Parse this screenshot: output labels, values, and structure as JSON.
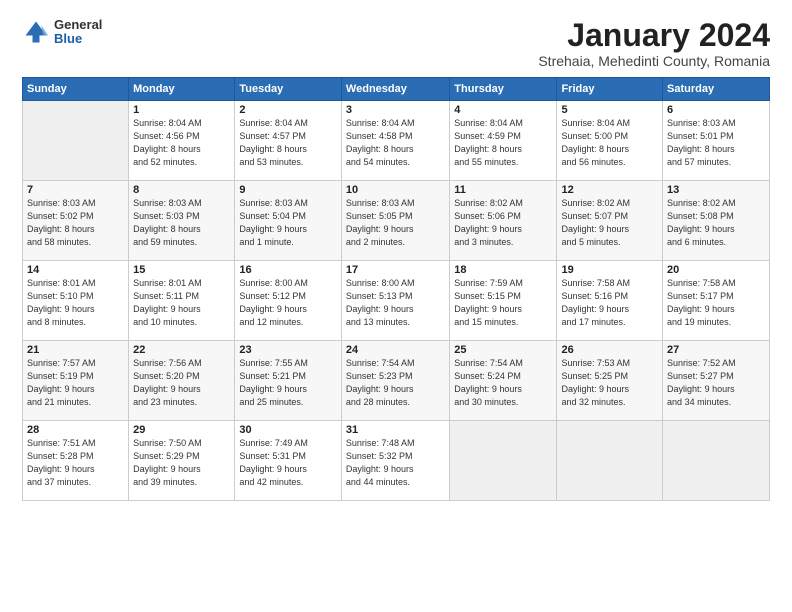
{
  "header": {
    "logo_general": "General",
    "logo_blue": "Blue",
    "month_year": "January 2024",
    "location": "Strehaia, Mehedinti County, Romania"
  },
  "calendar": {
    "days_of_week": [
      "Sunday",
      "Monday",
      "Tuesday",
      "Wednesday",
      "Thursday",
      "Friday",
      "Saturday"
    ],
    "weeks": [
      [
        {
          "day": "",
          "info": ""
        },
        {
          "day": "1",
          "info": "Sunrise: 8:04 AM\nSunset: 4:56 PM\nDaylight: 8 hours\nand 52 minutes."
        },
        {
          "day": "2",
          "info": "Sunrise: 8:04 AM\nSunset: 4:57 PM\nDaylight: 8 hours\nand 53 minutes."
        },
        {
          "day": "3",
          "info": "Sunrise: 8:04 AM\nSunset: 4:58 PM\nDaylight: 8 hours\nand 54 minutes."
        },
        {
          "day": "4",
          "info": "Sunrise: 8:04 AM\nSunset: 4:59 PM\nDaylight: 8 hours\nand 55 minutes."
        },
        {
          "day": "5",
          "info": "Sunrise: 8:04 AM\nSunset: 5:00 PM\nDaylight: 8 hours\nand 56 minutes."
        },
        {
          "day": "6",
          "info": "Sunrise: 8:03 AM\nSunset: 5:01 PM\nDaylight: 8 hours\nand 57 minutes."
        }
      ],
      [
        {
          "day": "7",
          "info": "Sunrise: 8:03 AM\nSunset: 5:02 PM\nDaylight: 8 hours\nand 58 minutes."
        },
        {
          "day": "8",
          "info": "Sunrise: 8:03 AM\nSunset: 5:03 PM\nDaylight: 8 hours\nand 59 minutes."
        },
        {
          "day": "9",
          "info": "Sunrise: 8:03 AM\nSunset: 5:04 PM\nDaylight: 9 hours\nand 1 minute."
        },
        {
          "day": "10",
          "info": "Sunrise: 8:03 AM\nSunset: 5:05 PM\nDaylight: 9 hours\nand 2 minutes."
        },
        {
          "day": "11",
          "info": "Sunrise: 8:02 AM\nSunset: 5:06 PM\nDaylight: 9 hours\nand 3 minutes."
        },
        {
          "day": "12",
          "info": "Sunrise: 8:02 AM\nSunset: 5:07 PM\nDaylight: 9 hours\nand 5 minutes."
        },
        {
          "day": "13",
          "info": "Sunrise: 8:02 AM\nSunset: 5:08 PM\nDaylight: 9 hours\nand 6 minutes."
        }
      ],
      [
        {
          "day": "14",
          "info": "Sunrise: 8:01 AM\nSunset: 5:10 PM\nDaylight: 9 hours\nand 8 minutes."
        },
        {
          "day": "15",
          "info": "Sunrise: 8:01 AM\nSunset: 5:11 PM\nDaylight: 9 hours\nand 10 minutes."
        },
        {
          "day": "16",
          "info": "Sunrise: 8:00 AM\nSunset: 5:12 PM\nDaylight: 9 hours\nand 12 minutes."
        },
        {
          "day": "17",
          "info": "Sunrise: 8:00 AM\nSunset: 5:13 PM\nDaylight: 9 hours\nand 13 minutes."
        },
        {
          "day": "18",
          "info": "Sunrise: 7:59 AM\nSunset: 5:15 PM\nDaylight: 9 hours\nand 15 minutes."
        },
        {
          "day": "19",
          "info": "Sunrise: 7:58 AM\nSunset: 5:16 PM\nDaylight: 9 hours\nand 17 minutes."
        },
        {
          "day": "20",
          "info": "Sunrise: 7:58 AM\nSunset: 5:17 PM\nDaylight: 9 hours\nand 19 minutes."
        }
      ],
      [
        {
          "day": "21",
          "info": "Sunrise: 7:57 AM\nSunset: 5:19 PM\nDaylight: 9 hours\nand 21 minutes."
        },
        {
          "day": "22",
          "info": "Sunrise: 7:56 AM\nSunset: 5:20 PM\nDaylight: 9 hours\nand 23 minutes."
        },
        {
          "day": "23",
          "info": "Sunrise: 7:55 AM\nSunset: 5:21 PM\nDaylight: 9 hours\nand 25 minutes."
        },
        {
          "day": "24",
          "info": "Sunrise: 7:54 AM\nSunset: 5:23 PM\nDaylight: 9 hours\nand 28 minutes."
        },
        {
          "day": "25",
          "info": "Sunrise: 7:54 AM\nSunset: 5:24 PM\nDaylight: 9 hours\nand 30 minutes."
        },
        {
          "day": "26",
          "info": "Sunrise: 7:53 AM\nSunset: 5:25 PM\nDaylight: 9 hours\nand 32 minutes."
        },
        {
          "day": "27",
          "info": "Sunrise: 7:52 AM\nSunset: 5:27 PM\nDaylight: 9 hours\nand 34 minutes."
        }
      ],
      [
        {
          "day": "28",
          "info": "Sunrise: 7:51 AM\nSunset: 5:28 PM\nDaylight: 9 hours\nand 37 minutes."
        },
        {
          "day": "29",
          "info": "Sunrise: 7:50 AM\nSunset: 5:29 PM\nDaylight: 9 hours\nand 39 minutes."
        },
        {
          "day": "30",
          "info": "Sunrise: 7:49 AM\nSunset: 5:31 PM\nDaylight: 9 hours\nand 42 minutes."
        },
        {
          "day": "31",
          "info": "Sunrise: 7:48 AM\nSunset: 5:32 PM\nDaylight: 9 hours\nand 44 minutes."
        },
        {
          "day": "",
          "info": ""
        },
        {
          "day": "",
          "info": ""
        },
        {
          "day": "",
          "info": ""
        }
      ]
    ]
  }
}
